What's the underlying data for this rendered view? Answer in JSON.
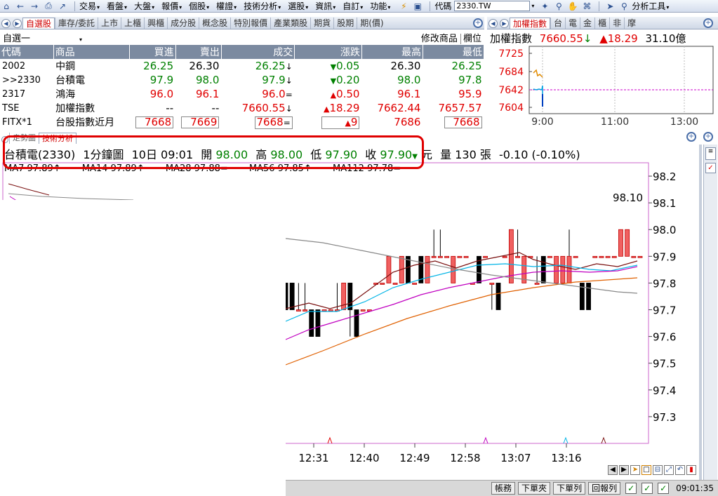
{
  "menubar": {
    "items": [
      "交易",
      "看盤",
      "大盤",
      "報價",
      "個股",
      "權證",
      "技術分析",
      "選股",
      "資訊",
      "自訂",
      "功能"
    ],
    "code_label": "代碼",
    "code_value": "2330.TW",
    "analysis_tool": "分析工具"
  },
  "quote": {
    "tabs": [
      "自選股",
      "庫存/委託",
      "上市",
      "上櫃",
      "興櫃",
      "成分股",
      "概念股",
      "特別報價",
      "產業類股",
      "期貨",
      "股期",
      "期(價)"
    ],
    "list_name": "自選一",
    "modify_label": "修改商品",
    "fields_label": "欄位",
    "columns": [
      "代碼",
      "商品",
      "買進",
      "賣出",
      "成交",
      "漲跌",
      "最高",
      "最低"
    ],
    "rows": [
      {
        "code": "2002",
        "name": "中鋼",
        "bid": "26.25",
        "ask": "26.30",
        "last": "26.25",
        "last_arrow": "↓",
        "chg": "0.05",
        "chg_dir": "dn",
        "high": "26.30",
        "low": "26.25",
        "bid_c": "dn",
        "ask_c": "fl",
        "last_c": "dn",
        "high_c": "fl",
        "low_c": "dn"
      },
      {
        "code": ">>2330",
        "name": "台積電",
        "bid": "97.9",
        "ask": "98.0",
        "last": "97.9",
        "last_arrow": "↓",
        "chg": "0.20",
        "chg_dir": "dn",
        "high": "98.0",
        "low": "97.8",
        "bid_c": "dn",
        "ask_c": "dn",
        "last_c": "dn",
        "high_c": "dn",
        "low_c": "dn"
      },
      {
        "code": "2317",
        "name": "鴻海",
        "bid": "96.0",
        "ask": "96.1",
        "last": "96.0",
        "last_arrow": "=",
        "chg": "0.50",
        "chg_dir": "up",
        "high": "96.1",
        "low": "95.9",
        "bid_c": "up",
        "ask_c": "up",
        "last_c": "up",
        "high_c": "up",
        "low_c": "up"
      },
      {
        "code": "TSE",
        "name": "加權指數",
        "bid": "--",
        "ask": "--",
        "last": "7660.55",
        "last_arrow": "↓",
        "chg": "18.29",
        "chg_dir": "up",
        "high": "7662.44",
        "low": "7657.57",
        "bid_c": "fl",
        "ask_c": "fl",
        "last_c": "up",
        "high_c": "up",
        "low_c": "up"
      },
      {
        "code": "FITX*1",
        "name": "台股指數近月",
        "bid": "7668",
        "ask": "7669",
        "last": "7668",
        "last_arrow": "=",
        "chg": "9",
        "chg_dir": "up",
        "high": "7686",
        "low": "7668",
        "bid_c": "up",
        "ask_c": "up",
        "last_c": "up",
        "high_c": "up",
        "low_c": "up"
      }
    ]
  },
  "index": {
    "tabs": [
      "加權指數",
      "台",
      "電",
      "金",
      "櫃",
      "非",
      "摩"
    ],
    "name": "加權指數",
    "value": "7660.55",
    "arrow": "↓",
    "change": "▲18.29",
    "volume": "31.10億",
    "yticks": [
      "7725",
      "7684",
      "7642",
      "7604"
    ],
    "xticks": [
      "9:00",
      "11:00",
      "13:00"
    ]
  },
  "chart": {
    "tabs": [
      "走勢圖",
      "技術分析"
    ],
    "stock": "台積電(2330)",
    "period": "1分鐘圖",
    "datetime": "10日 09:01",
    "open_label": "開",
    "open": "98.00",
    "high_label": "高",
    "high": "98.00",
    "low_label": "低",
    "low": "97.90",
    "close_label": "收",
    "close": "97.90",
    "close_arrow": "▼",
    "unit": "元",
    "volume_label": "量",
    "volume": "130",
    "volume_unit": "張",
    "change": "-0.10 (-0.10%)",
    "ma": [
      {
        "label": "MA7",
        "value": "97.89",
        "mark": "↑",
        "color": "#e00000"
      },
      {
        "label": "MA14",
        "value": "97.89",
        "mark": "↑",
        "color": "#00b4e6"
      },
      {
        "label": "MA28",
        "value": "97.88",
        "mark": "=",
        "color": "#e00000"
      },
      {
        "label": "MA56",
        "value": "97.85",
        "mark": "↑",
        "color": "#ff5a00"
      },
      {
        "label": "MA112",
        "value": "97.78",
        "mark": "=",
        "color": "#888888"
      }
    ],
    "max_label": "98.10"
  },
  "chart_data": {
    "type": "candlestick",
    "title": "台積電(2330) 1分鐘圖",
    "yticks": [
      98.2,
      98.1,
      98.0,
      97.9,
      97.8,
      97.7,
      97.6,
      97.5,
      97.4,
      97.3
    ],
    "ylim": [
      97.2,
      98.25
    ],
    "xticks": [
      "12:31",
      "12:40",
      "12:49",
      "12:58",
      "13:07",
      "13:16"
    ],
    "candles": [
      [
        97.8,
        97.7,
        97.8,
        97.7
      ],
      [
        97.8,
        97.7,
        97.8,
        97.7
      ],
      [
        97.7,
        97.7,
        97.8,
        97.7
      ],
      [
        97.7,
        97.7,
        97.8,
        97.7
      ],
      [
        97.7,
        97.6,
        97.7,
        97.6
      ],
      [
        97.7,
        97.6,
        97.7,
        97.6
      ],
      [
        97.7,
        97.7,
        97.7,
        97.7
      ],
      [
        97.7,
        97.7,
        97.7,
        97.7
      ],
      [
        97.7,
        97.7,
        97.8,
        97.7
      ],
      [
        97.7,
        97.8,
        97.8,
        97.7
      ],
      [
        97.8,
        97.7,
        97.8,
        97.6
      ],
      [
        97.7,
        97.6,
        97.7,
        97.6
      ],
      [
        97.7,
        97.7,
        97.7,
        97.7
      ],
      [
        97.7,
        97.7,
        97.7,
        97.7
      ],
      [
        97.8,
        97.8,
        97.8,
        97.8
      ],
      [
        97.8,
        97.8,
        97.8,
        97.8
      ],
      [
        97.8,
        97.9,
        97.9,
        97.8
      ],
      [
        97.8,
        97.8,
        97.8,
        97.8
      ],
      [
        97.8,
        97.9,
        97.9,
        97.8
      ],
      [
        97.9,
        97.8,
        97.9,
        97.8
      ],
      [
        97.8,
        97.8,
        97.8,
        97.8
      ],
      [
        97.9,
        97.8,
        97.9,
        97.8
      ],
      [
        97.8,
        97.9,
        97.9,
        97.8
      ],
      [
        97.9,
        97.9,
        98.0,
        97.9
      ],
      [
        97.9,
        97.9,
        98.0,
        97.9
      ],
      [
        97.9,
        97.9,
        97.9,
        97.9
      ],
      [
        97.8,
        97.9,
        97.9,
        97.8
      ],
      [
        97.9,
        97.9,
        97.9,
        97.9
      ],
      [
        97.9,
        97.9,
        97.9,
        97.9
      ],
      [
        97.8,
        97.8,
        97.8,
        97.8
      ],
      [
        97.9,
        97.8,
        97.9,
        97.8
      ],
      [
        97.9,
        97.9,
        97.9,
        97.9
      ],
      [
        97.8,
        97.8,
        97.8,
        97.7
      ],
      [
        97.8,
        97.7,
        97.8,
        97.7
      ],
      [
        97.9,
        97.9,
        97.9,
        97.9
      ],
      [
        97.8,
        98.0,
        98.0,
        97.8
      ],
      [
        97.9,
        97.9,
        98.0,
        97.9
      ],
      [
        97.8,
        97.9,
        97.9,
        97.8
      ],
      [
        97.9,
        97.9,
        97.9,
        97.9
      ],
      [
        97.8,
        97.8,
        97.9,
        97.8
      ],
      [
        97.9,
        97.8,
        97.9,
        97.8
      ],
      [
        97.9,
        97.9,
        97.9,
        97.9
      ],
      [
        97.8,
        97.9,
        97.9,
        97.8
      ],
      [
        97.8,
        97.9,
        97.9,
        97.8
      ],
      [
        97.8,
        97.9,
        98.0,
        97.8
      ],
      [
        97.9,
        97.9,
        97.9,
        97.9
      ],
      [
        97.8,
        97.7,
        97.8,
        97.7
      ],
      [
        97.8,
        97.7,
        97.8,
        97.7
      ],
      [
        97.9,
        97.9,
        97.9,
        97.9
      ],
      [
        97.9,
        97.9,
        97.9,
        97.9
      ],
      [
        97.9,
        97.9,
        97.9,
        97.9
      ],
      [
        97.9,
        97.9,
        97.9,
        97.9
      ],
      [
        97.9,
        98.0,
        98.0,
        97.9
      ],
      [
        97.9,
        98.0,
        98.0,
        97.9
      ],
      [
        97.9,
        97.9,
        97.9,
        97.9
      ],
      [
        97.9,
        97.9,
        97.9,
        97.9
      ]
    ]
  },
  "statusbar": {
    "buttons": [
      "帳務",
      "下單夾",
      "下單列",
      "回報列"
    ],
    "time": "09:01:35"
  }
}
